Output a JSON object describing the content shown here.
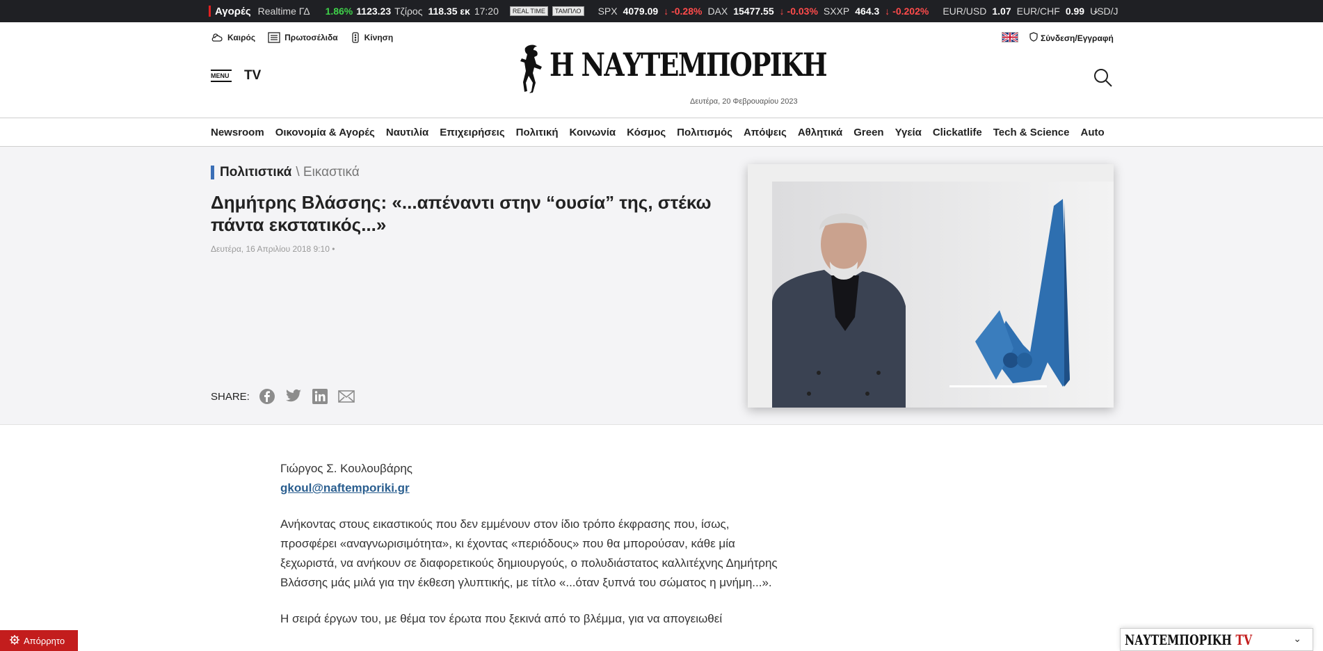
{
  "ticker": {
    "label": "Αγορές",
    "realtime": "Realtime ΓΔ",
    "gd_change": "1.86%",
    "gd_value": "1123.23",
    "turnover_label": "Τζίρος",
    "turnover_value": "118.35 εκ",
    "time": "17:20",
    "tag_realtime": "REAL TIME",
    "tag_board": "ΤΑΜΠΛΟ",
    "items": [
      {
        "name": "SPX",
        "value": "4079.09",
        "change": "↓ -0.28%"
      },
      {
        "name": "DAX",
        "value": "15477.55",
        "change": "↓ -0.03%"
      },
      {
        "name": "SXXP",
        "value": "464.3",
        "change": "↓ -0.202%"
      }
    ],
    "fx": [
      {
        "name": "EUR/USD",
        "value": "1.07"
      },
      {
        "name": "EUR/CHF",
        "value": "0.99"
      },
      {
        "name": "USD/J",
        "value": ""
      }
    ]
  },
  "header": {
    "links": [
      "Καιρός",
      "Πρωτοσέλιδα",
      "Κίνηση"
    ],
    "menu_label": "MENU",
    "tv_label": "TV",
    "logo_text": "Η ΝΑΥΤΕΜΠΟΡΙΚΗ",
    "date": "Δευτέρα, 20 Φεβρουαρίου 2023",
    "login": "Σύνδεση/Εγγραφή"
  },
  "nav": [
    "Newsroom",
    "Οικονομία & Αγορές",
    "Ναυτιλία",
    "Επιχειρήσεις",
    "Πολιτική",
    "Κοινωνία",
    "Κόσμος",
    "Πολιτισμός",
    "Απόψεις",
    "Αθλητικά",
    "Green",
    "Υγεία",
    "Clickatlife",
    "Tech & Science",
    "Auto"
  ],
  "article": {
    "category": "Πολιτιστικά",
    "subcategory": "\\ Εικαστικά",
    "title": "Δημήτρης Βλάσσης: «...απέναντι στην “ουσία” της, στέκω πάντα εκστατικός...»",
    "date": "Δευτέρα, 16 Απριλίου 2018 9:10 •",
    "share_label": "SHARE:",
    "author": "Γιώργος Σ. Κουλουβάρης",
    "email": "gkoul@naftemporiki.gr",
    "paragraph1": "Ανήκοντας στους εικαστικούς που δεν εμμένουν στον ίδιο τρόπο έκφρασης που, ίσως, προσφέρει «αναγνωρισιμότητα», κι έχοντας «περιόδους» που θα μπορούσαν, κάθε μία ξεχωριστά, να ανήκουν σε διαφορετικούς δημιουργούς, ο πολυδιάστατος καλλιτέχνης Δημήτρης Βλάσσης μάς μιλά για την έκθεση γλυπτικής, με τίτλο «...όταν ξυπνά του σώματος η μνήμη...».",
    "paragraph2": "Η σειρά έργων του, με θέμα τον έρωτα που ξεκινά από το βλέμμα, για να απογειωθεί"
  },
  "footer": {
    "privacy": "Απόρρητο",
    "tv_brand": "ΝΑΥΤΕΜΠΟΡΙΚΗ",
    "tv_suffix": "TV"
  },
  "colors": {
    "accent": "#3b6fb6",
    "ticker_bg": "#1f2024",
    "up": "#3fd34a",
    "down": "#ff4b4b",
    "privacy": "#c31d1d"
  }
}
